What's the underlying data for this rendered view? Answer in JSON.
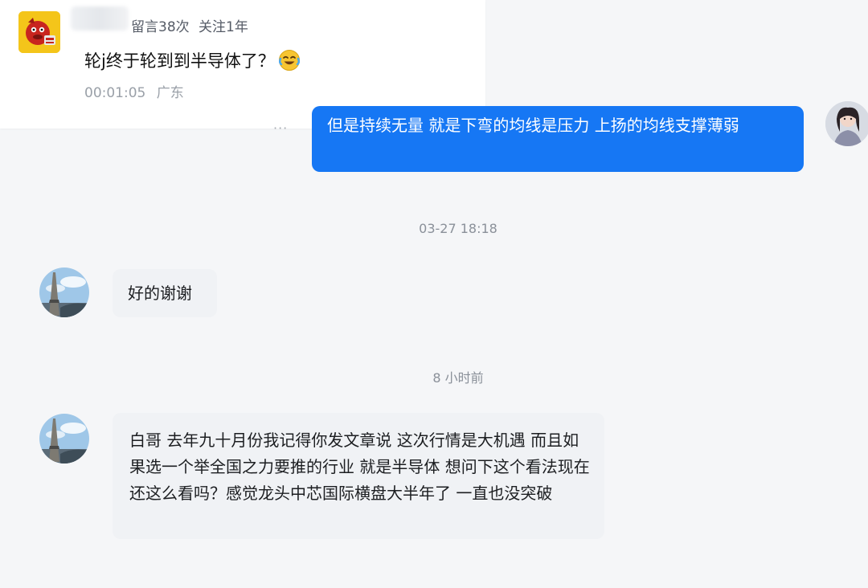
{
  "comment": {
    "meta_count": "留言38次",
    "meta_follow": "关注1年",
    "text": "轮j终于轮到到半导体了？",
    "emoji_icon": "crying-laughing-emoji",
    "time": "00:01:05",
    "location": "广东"
  },
  "chat": {
    "more_label": "···",
    "outgoing_message": "但是持续无量 就是下弯的均线是压力 上扬的均线支撑薄弱",
    "timestamp_1": "03-27 18:18",
    "incoming_message_1": "好的谢谢",
    "timestamp_2": "8 小时前",
    "incoming_message_2": "白哥 去年九十月份我记得你发文章说 这次行情是大机遇 而且如果选一个举全国之力要推的行业 就是半导体 想问下这个看法现在还这么看吗？感觉龙头中芯国际横盘大半年了 一直也没突破"
  },
  "colors": {
    "outgoing_bubble": "#1677f4",
    "incoming_bubble": "#f0f2f5",
    "background": "#f5f6f8",
    "comment_avatar": "#f4c51a"
  }
}
